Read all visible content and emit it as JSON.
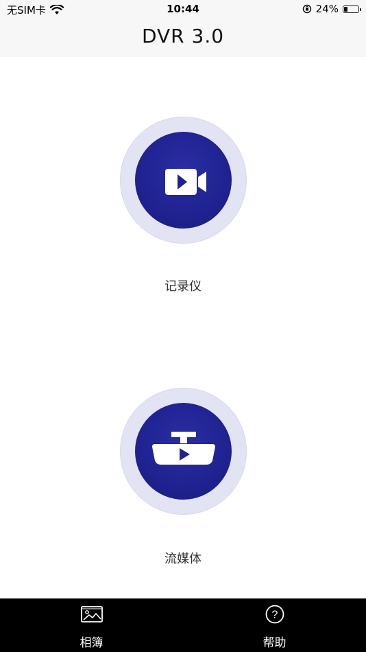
{
  "status_bar": {
    "carrier": "无SIM卡",
    "time": "10:44",
    "battery_percent": "24%",
    "battery_level": 0.24
  },
  "nav": {
    "title": "DVR 3.0"
  },
  "features": [
    {
      "label": "记录仪",
      "icon": "video-camera-icon"
    },
    {
      "label": "流媒体",
      "icon": "rearview-mirror-play-icon"
    }
  ],
  "tabs": [
    {
      "label": "相簿",
      "icon": "photo-album-icon"
    },
    {
      "label": "帮助",
      "icon": "help-icon"
    }
  ],
  "colors": {
    "accent": "#1f2290",
    "halo": "#e3e4f3",
    "tab_bar": "#000000"
  }
}
